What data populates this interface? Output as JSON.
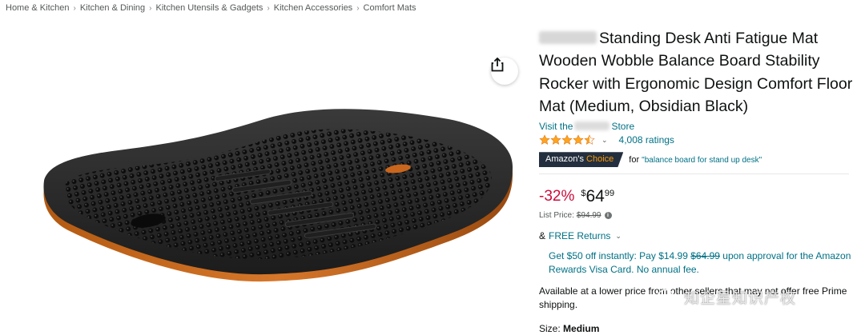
{
  "breadcrumb": [
    "Home & Kitchen",
    "Kitchen & Dining",
    "Kitchen Utensils & Gadgets",
    "Kitchen Accessories",
    "Comfort Mats"
  ],
  "product": {
    "title": "Standing Desk Anti Fatigue Mat Wooden Wobble Balance Board Stability Rocker with Ergonomic Design Comfort Floor Mat (Medium, Obsidian Black)",
    "store_prefix": "Visit the",
    "store_suffix": "Store",
    "rating_value": 4.5,
    "rating_count": "4,008 ratings",
    "choice_badge_part1": "Amazon's",
    "choice_badge_part2": "Choice",
    "choice_for": "for",
    "choice_query": "\"balance board for stand up desk\""
  },
  "price": {
    "discount": "-32%",
    "symbol": "$",
    "whole": "64",
    "fraction": "99",
    "list_label": "List Price:",
    "list_value": "$94.99",
    "info_icon": "i"
  },
  "returns": {
    "prefix": "&",
    "link": "FREE Returns",
    "chevron": "⌄"
  },
  "promo": {
    "text1": "Get $50 off instantly: Pay $14.99",
    "strike": "$64.99",
    "text2": "upon approval for the Amazon Rewards Visa Card. No annual fee."
  },
  "availability": {
    "text": "Available at a lower price from other sellers that may not offer free Prime shipping."
  },
  "size": {
    "label": "Size:",
    "value": "Medium"
  },
  "watermark": {
    "text": "知企星知识产权"
  },
  "colors": {
    "link": "#007185",
    "discount": "#cc0c39",
    "badge_bg": "#232f3e",
    "badge_accent": "#ff9900",
    "star": "#ffa41c"
  }
}
